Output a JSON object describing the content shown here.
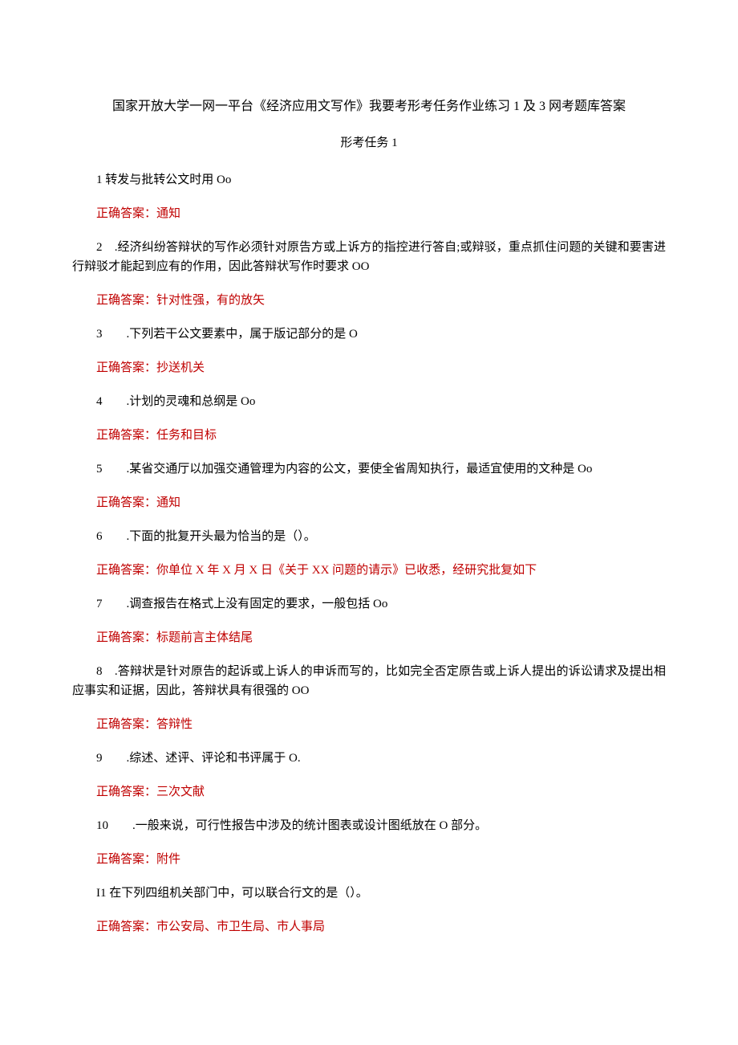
{
  "title": "国家开放大学一网一平台《经济应用文写作》我要考形考任务作业练习 1 及 3 网考题库答案",
  "subtitle": "形考任务 1",
  "items": [
    {
      "q": "1 转发与批转公文时用 Oo",
      "a": "正确答案：通知"
    },
    {
      "q": "2　.经济纠纷答辩状的写作必须针对原告方或上诉方的指控进行答自;或辩驳，重点抓住问题的关键和要害进行辩驳才能起到应有的作用，因此答辩状写作时要求 OO",
      "a": "正确答案：针对性强，有的放矢"
    },
    {
      "q": "3　　.下列若干公文要素中，属于版记部分的是 O",
      "a": "正确答案：抄送机关"
    },
    {
      "q": "4　　.计划的灵魂和总纲是 Oo",
      "a": "正确答案：任务和目标"
    },
    {
      "q": "5　　.某省交通厅以加强交通管理为内容的公文，要使全省周知执行，最适宜使用的文种是 Oo",
      "a": "正确答案：通知"
    },
    {
      "q": "6　　.下面的批复开头最为恰当的是（）。",
      "a": "正确答案：你单位 X 年 X 月 X 日《关于 XX 问题的请示》已收悉，经研究批复如下"
    },
    {
      "q": "7　　.调查报告在格式上没有固定的要求，一般包括 Oo",
      "a": "正确答案：标题前言主体结尾"
    },
    {
      "q": "8　.答辩状是针对原告的起诉或上诉人的申诉而写的，比如完全否定原告或上诉人提出的诉讼请求及提出相应事实和证据，因此，答辩状具有很强的 OO",
      "a": "正确答案：答辩性"
    },
    {
      "q": "9　　.综述、述评、评论和书评属于 O.",
      "a": "正确答案：三次文献"
    },
    {
      "q": "10　　.一般来说，可行性报告中涉及的统计图表或设计图纸放在 O 部分。",
      "a": "正确答案：附件"
    },
    {
      "q": "I1 在下列四组机关部门中，可以联合行文的是（）。",
      "a": "正确答案：市公安局、市卫生局、市人事局"
    }
  ]
}
